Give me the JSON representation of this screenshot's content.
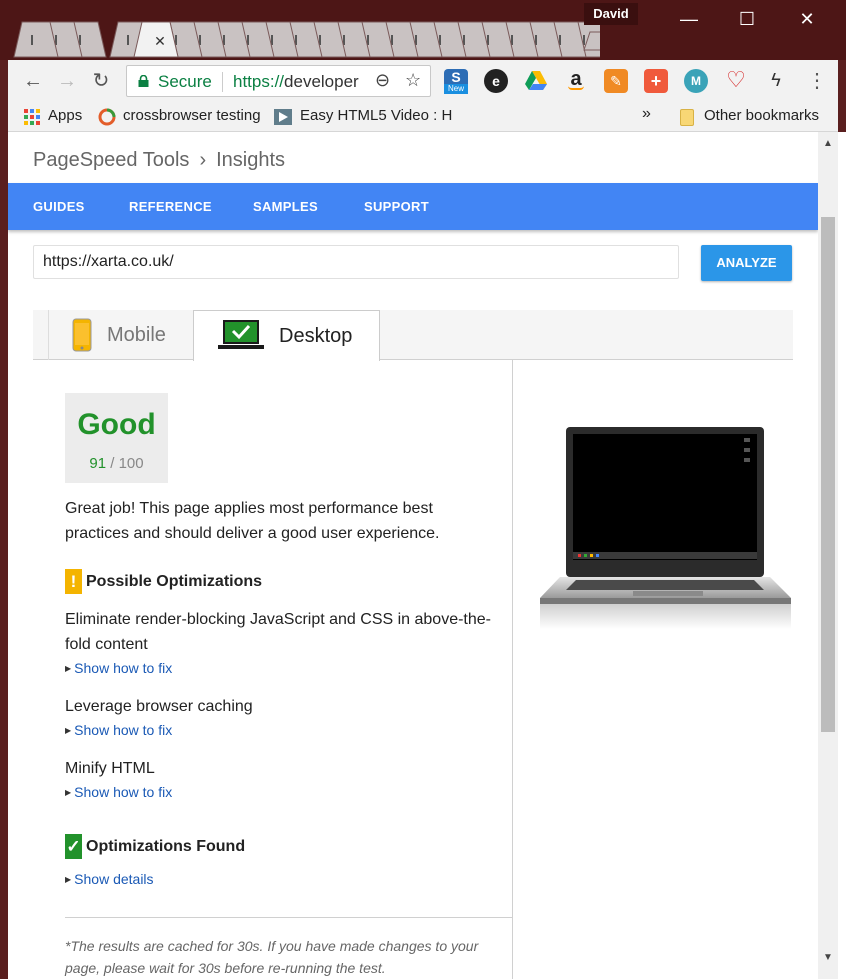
{
  "window": {
    "user": "David",
    "controls": {
      "minimize": "—",
      "maximize": "☐",
      "close": "✕"
    },
    "tab_close": "✕"
  },
  "toolbar": {
    "secure_label": "Secure",
    "url_scheme": "https://",
    "url_rest": "developer",
    "new_badge": "New",
    "menu": "⋮"
  },
  "bookmarks": {
    "apps": "Apps",
    "items": [
      "crossbrowser testing",
      "Easy HTML5 Video : H"
    ],
    "overflow": "»",
    "other": "Other bookmarks"
  },
  "page": {
    "breadcrumb": {
      "parent": "PageSpeed Tools",
      "current": "Insights"
    },
    "nav": [
      "GUIDES",
      "REFERENCE",
      "SAMPLES",
      "SUPPORT"
    ],
    "url_value": "https://xarta.co.uk/",
    "analyze_label": "ANALYZE",
    "tabs": {
      "mobile": "Mobile",
      "desktop": "Desktop",
      "selected": "Desktop"
    },
    "score": {
      "rating": "Good",
      "value": "91",
      "max": "/ 100"
    },
    "summary": "Great job! This page applies most performance best practices and should deliver a good user experience.",
    "possible": {
      "title": "Possible Optimizations",
      "items": [
        {
          "title": "Eliminate render-blocking JavaScript and CSS in above-the-fold content",
          "link": "Show how to fix"
        },
        {
          "title": "Leverage browser caching",
          "link": "Show how to fix"
        },
        {
          "title": "Minify HTML",
          "link": "Show how to fix"
        }
      ]
    },
    "found": {
      "title": "Optimizations Found",
      "link": "Show details"
    },
    "note": "*The results are cached for 30s. If you have made changes to your page, please wait for 30s before re-running the test."
  },
  "colors": {
    "nav_bar": "#4285f4",
    "analyze": "#2b96e8",
    "good": "#22922b",
    "warning": "#f4b400",
    "link": "#1a59b5"
  }
}
